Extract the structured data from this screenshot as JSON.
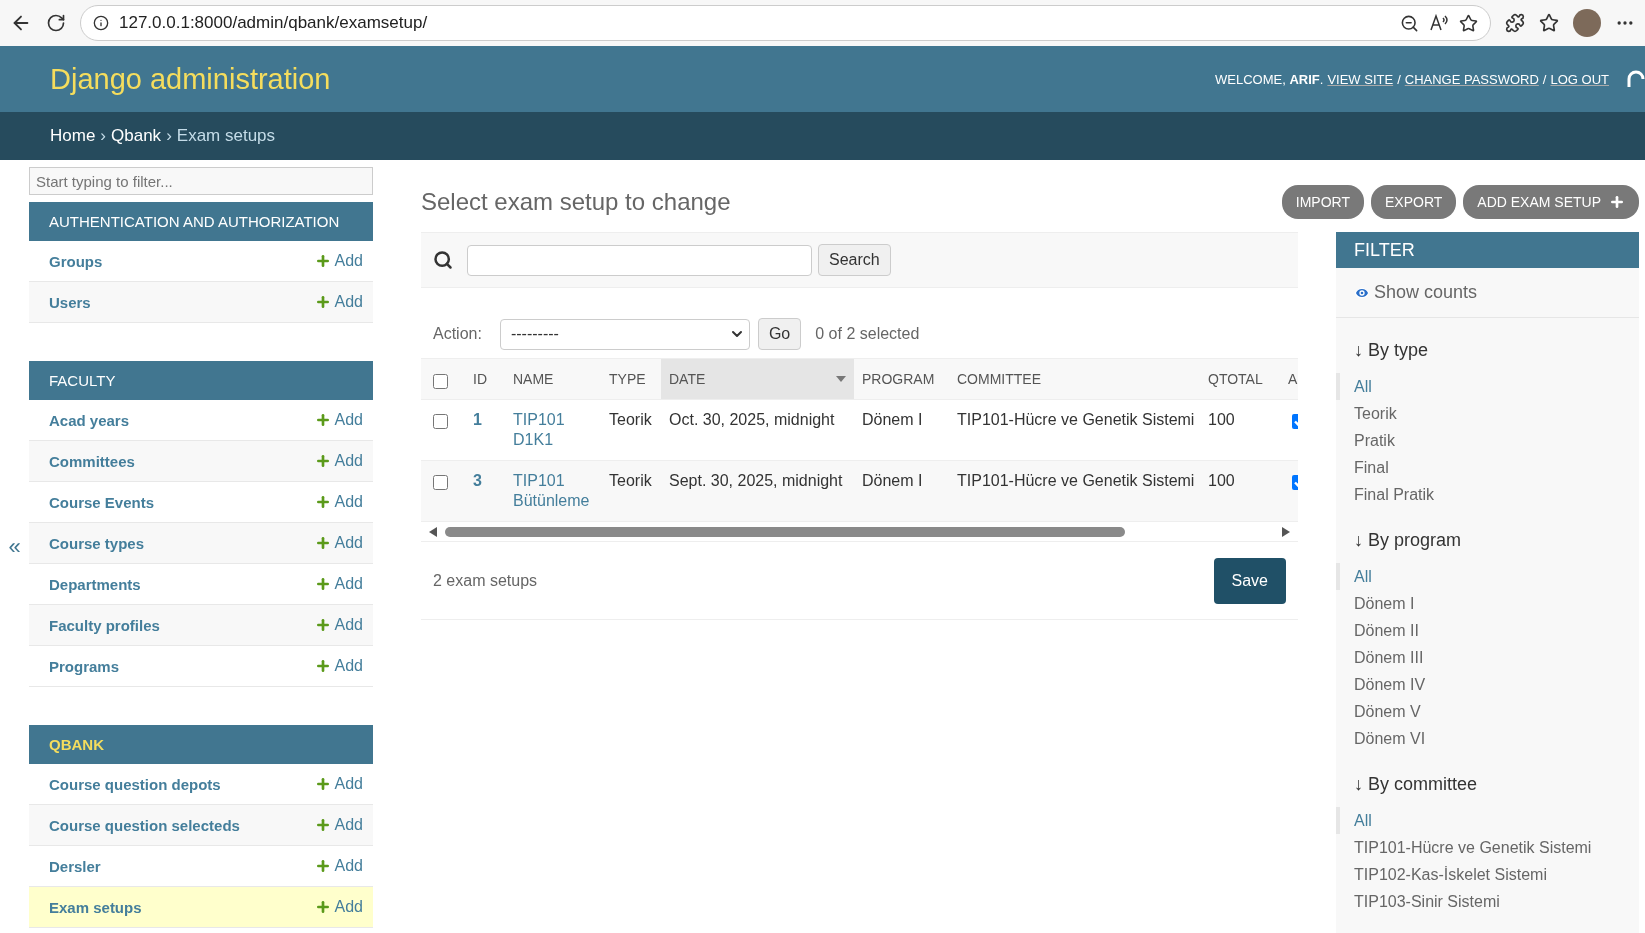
{
  "browser": {
    "url": "127.0.0.1:8000/admin/qbank/examsetup/"
  },
  "header": {
    "title": "Django administration",
    "welcome": "WELCOME,",
    "user": "ARIF",
    "user_suffix": ".",
    "links": [
      "VIEW SITE",
      "CHANGE PASSWORD",
      "LOG OUT"
    ],
    "separator": "/"
  },
  "breadcrumbs": [
    "Home",
    "Qbank",
    "Exam setups"
  ],
  "breadcrumb_separator": "›",
  "sidebar": {
    "toggle": "«",
    "filter_placeholder": "Start typing to filter...",
    "sections": [
      {
        "title": "AUTHENTICATION AND AUTHORIZATION",
        "selected": false,
        "items": [
          {
            "label": "Groups",
            "add": "Add",
            "selected": false
          },
          {
            "label": "Users",
            "add": "Add",
            "selected": false
          }
        ]
      },
      {
        "title": "FACULTY",
        "selected": false,
        "items": [
          {
            "label": "Acad years",
            "add": "Add",
            "selected": false
          },
          {
            "label": "Committees",
            "add": "Add",
            "selected": false
          },
          {
            "label": "Course Events",
            "add": "Add",
            "selected": false
          },
          {
            "label": "Course types",
            "add": "Add",
            "selected": false
          },
          {
            "label": "Departments",
            "add": "Add",
            "selected": false
          },
          {
            "label": "Faculty profiles",
            "add": "Add",
            "selected": false
          },
          {
            "label": "Programs",
            "add": "Add",
            "selected": false
          }
        ]
      },
      {
        "title": "QBANK",
        "selected": true,
        "items": [
          {
            "label": "Course question depots",
            "add": "Add",
            "selected": false
          },
          {
            "label": "Course question selecteds",
            "add": "Add",
            "selected": false
          },
          {
            "label": "Dersler",
            "add": "Add",
            "selected": false
          },
          {
            "label": "Exam setups",
            "add": "Add",
            "selected": true
          }
        ]
      }
    ]
  },
  "main": {
    "title": "Select exam setup to change",
    "tools": [
      "IMPORT",
      "EXPORT",
      "ADD EXAM SETUP"
    ],
    "search_button": "Search",
    "action_label": "Action:",
    "action_value": "---------",
    "go": "Go",
    "select_all": false,
    "counter": "0 of 2 selected",
    "columns": [
      {
        "label": "ID",
        "sorted": false
      },
      {
        "label": "NAME",
        "sorted": false
      },
      {
        "label": "TYPE",
        "sorted": false
      },
      {
        "label": "DATE",
        "sorted": true
      },
      {
        "label": "PROGRAM",
        "sorted": false
      },
      {
        "label": "COMMITTEE",
        "sorted": false
      },
      {
        "label": "QTOTAL",
        "sorted": false
      },
      {
        "label": "A",
        "sorted": false
      }
    ],
    "rows": [
      {
        "checked": false,
        "id": "1",
        "name": [
          "TIP101",
          "D1K1"
        ],
        "type": "Teorik",
        "date": "Oct. 30, 2025, midnight",
        "program": "Dönem I",
        "committee": "TIP101-Hücre ve Genetik Sistemi",
        "qtotal": "100",
        "column_8": true
      },
      {
        "checked": false,
        "id": "3",
        "name": [
          "TIP101",
          "Bütünleme"
        ],
        "type": "Teorik",
        "date": "Sept. 30, 2025, midnight",
        "program": "Dönem I",
        "committee": "TIP101-Hücre ve Genetik Sistemi",
        "qtotal": "100",
        "column_8": true
      }
    ],
    "count": "2 exam setups",
    "save": "Save"
  },
  "filter": {
    "title": "FILTER",
    "show_counts": "Show counts",
    "groups": [
      {
        "title": "↓ By type",
        "options": [
          {
            "label": "All",
            "selected": true
          },
          {
            "label": "Teorik",
            "selected": false
          },
          {
            "label": "Pratik",
            "selected": false
          },
          {
            "label": "Final",
            "selected": false
          },
          {
            "label": "Final Pratik",
            "selected": false
          }
        ]
      },
      {
        "title": "↓ By program",
        "options": [
          {
            "label": "All",
            "selected": true
          },
          {
            "label": "Dönem I",
            "selected": false
          },
          {
            "label": "Dönem II",
            "selected": false
          },
          {
            "label": "Dönem III",
            "selected": false
          },
          {
            "label": "Dönem IV",
            "selected": false
          },
          {
            "label": "Dönem V",
            "selected": false
          },
          {
            "label": "Dönem VI",
            "selected": false
          }
        ]
      },
      {
        "title": "↓ By committee",
        "options": [
          {
            "label": "All",
            "selected": true
          },
          {
            "label": "TIP101-Hücre ve Genetik Sistemi",
            "selected": false
          },
          {
            "label": "TIP102-Kas-İskelet Sistemi",
            "selected": false
          },
          {
            "label": "TIP103-Sinir Sistemi",
            "selected": false
          }
        ]
      }
    ]
  }
}
